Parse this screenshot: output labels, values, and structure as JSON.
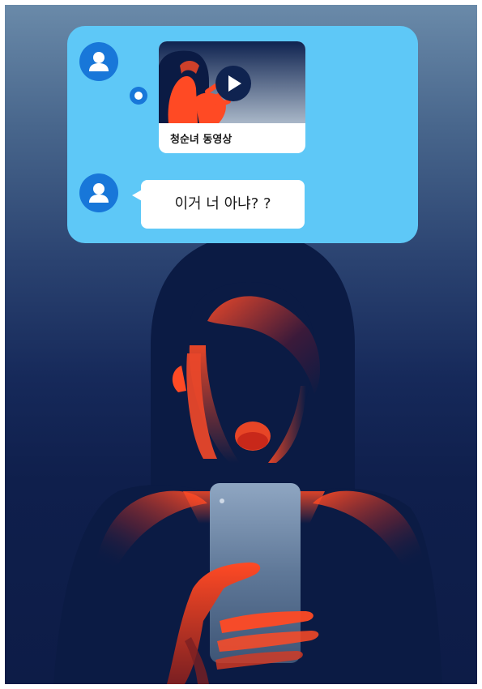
{
  "chat": {
    "video_title": "청순녀 동영상",
    "message": "이거 너 아냐? ?"
  },
  "icons": {
    "avatar": "user-avatar-icon",
    "play": "play-icon",
    "typing": "typing-indicator-icon"
  },
  "colors": {
    "chat_bubble": "#5ec8f7",
    "avatar": "#1877d9",
    "figure": "#0b1b44",
    "highlight": "#ff4a24",
    "phone": "#5a7190"
  }
}
